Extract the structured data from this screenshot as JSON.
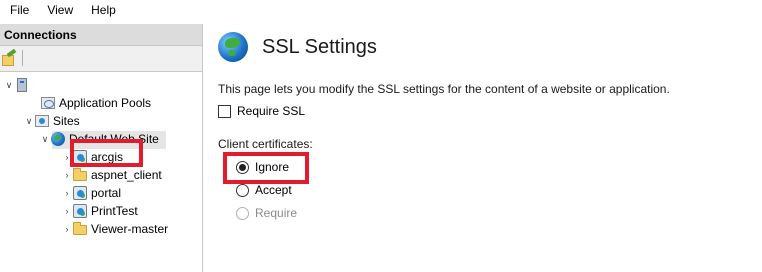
{
  "menu": {
    "items": [
      "File",
      "View",
      "Help"
    ]
  },
  "connections": {
    "header": "Connections",
    "tree": {
      "server_label": "",
      "application_pools": "Application Pools",
      "sites": "Sites",
      "default_web_site": "Default Web Site",
      "children": [
        "arcgis",
        "aspnet_client",
        "portal",
        "PrintTest",
        "Viewer-master"
      ]
    }
  },
  "ssl": {
    "title": "SSL Settings",
    "description": "This page lets you modify the SSL settings for the content of a website or application.",
    "require_ssl_label": "Require SSL",
    "require_ssl_checked": false,
    "client_certificates_label": "Client certificates:",
    "options": [
      "Ignore",
      "Accept",
      "Require"
    ],
    "selected_option": "Ignore"
  },
  "colors": {
    "highlight_box": "#e11d2b",
    "header_bg": "#dcdcdc"
  }
}
